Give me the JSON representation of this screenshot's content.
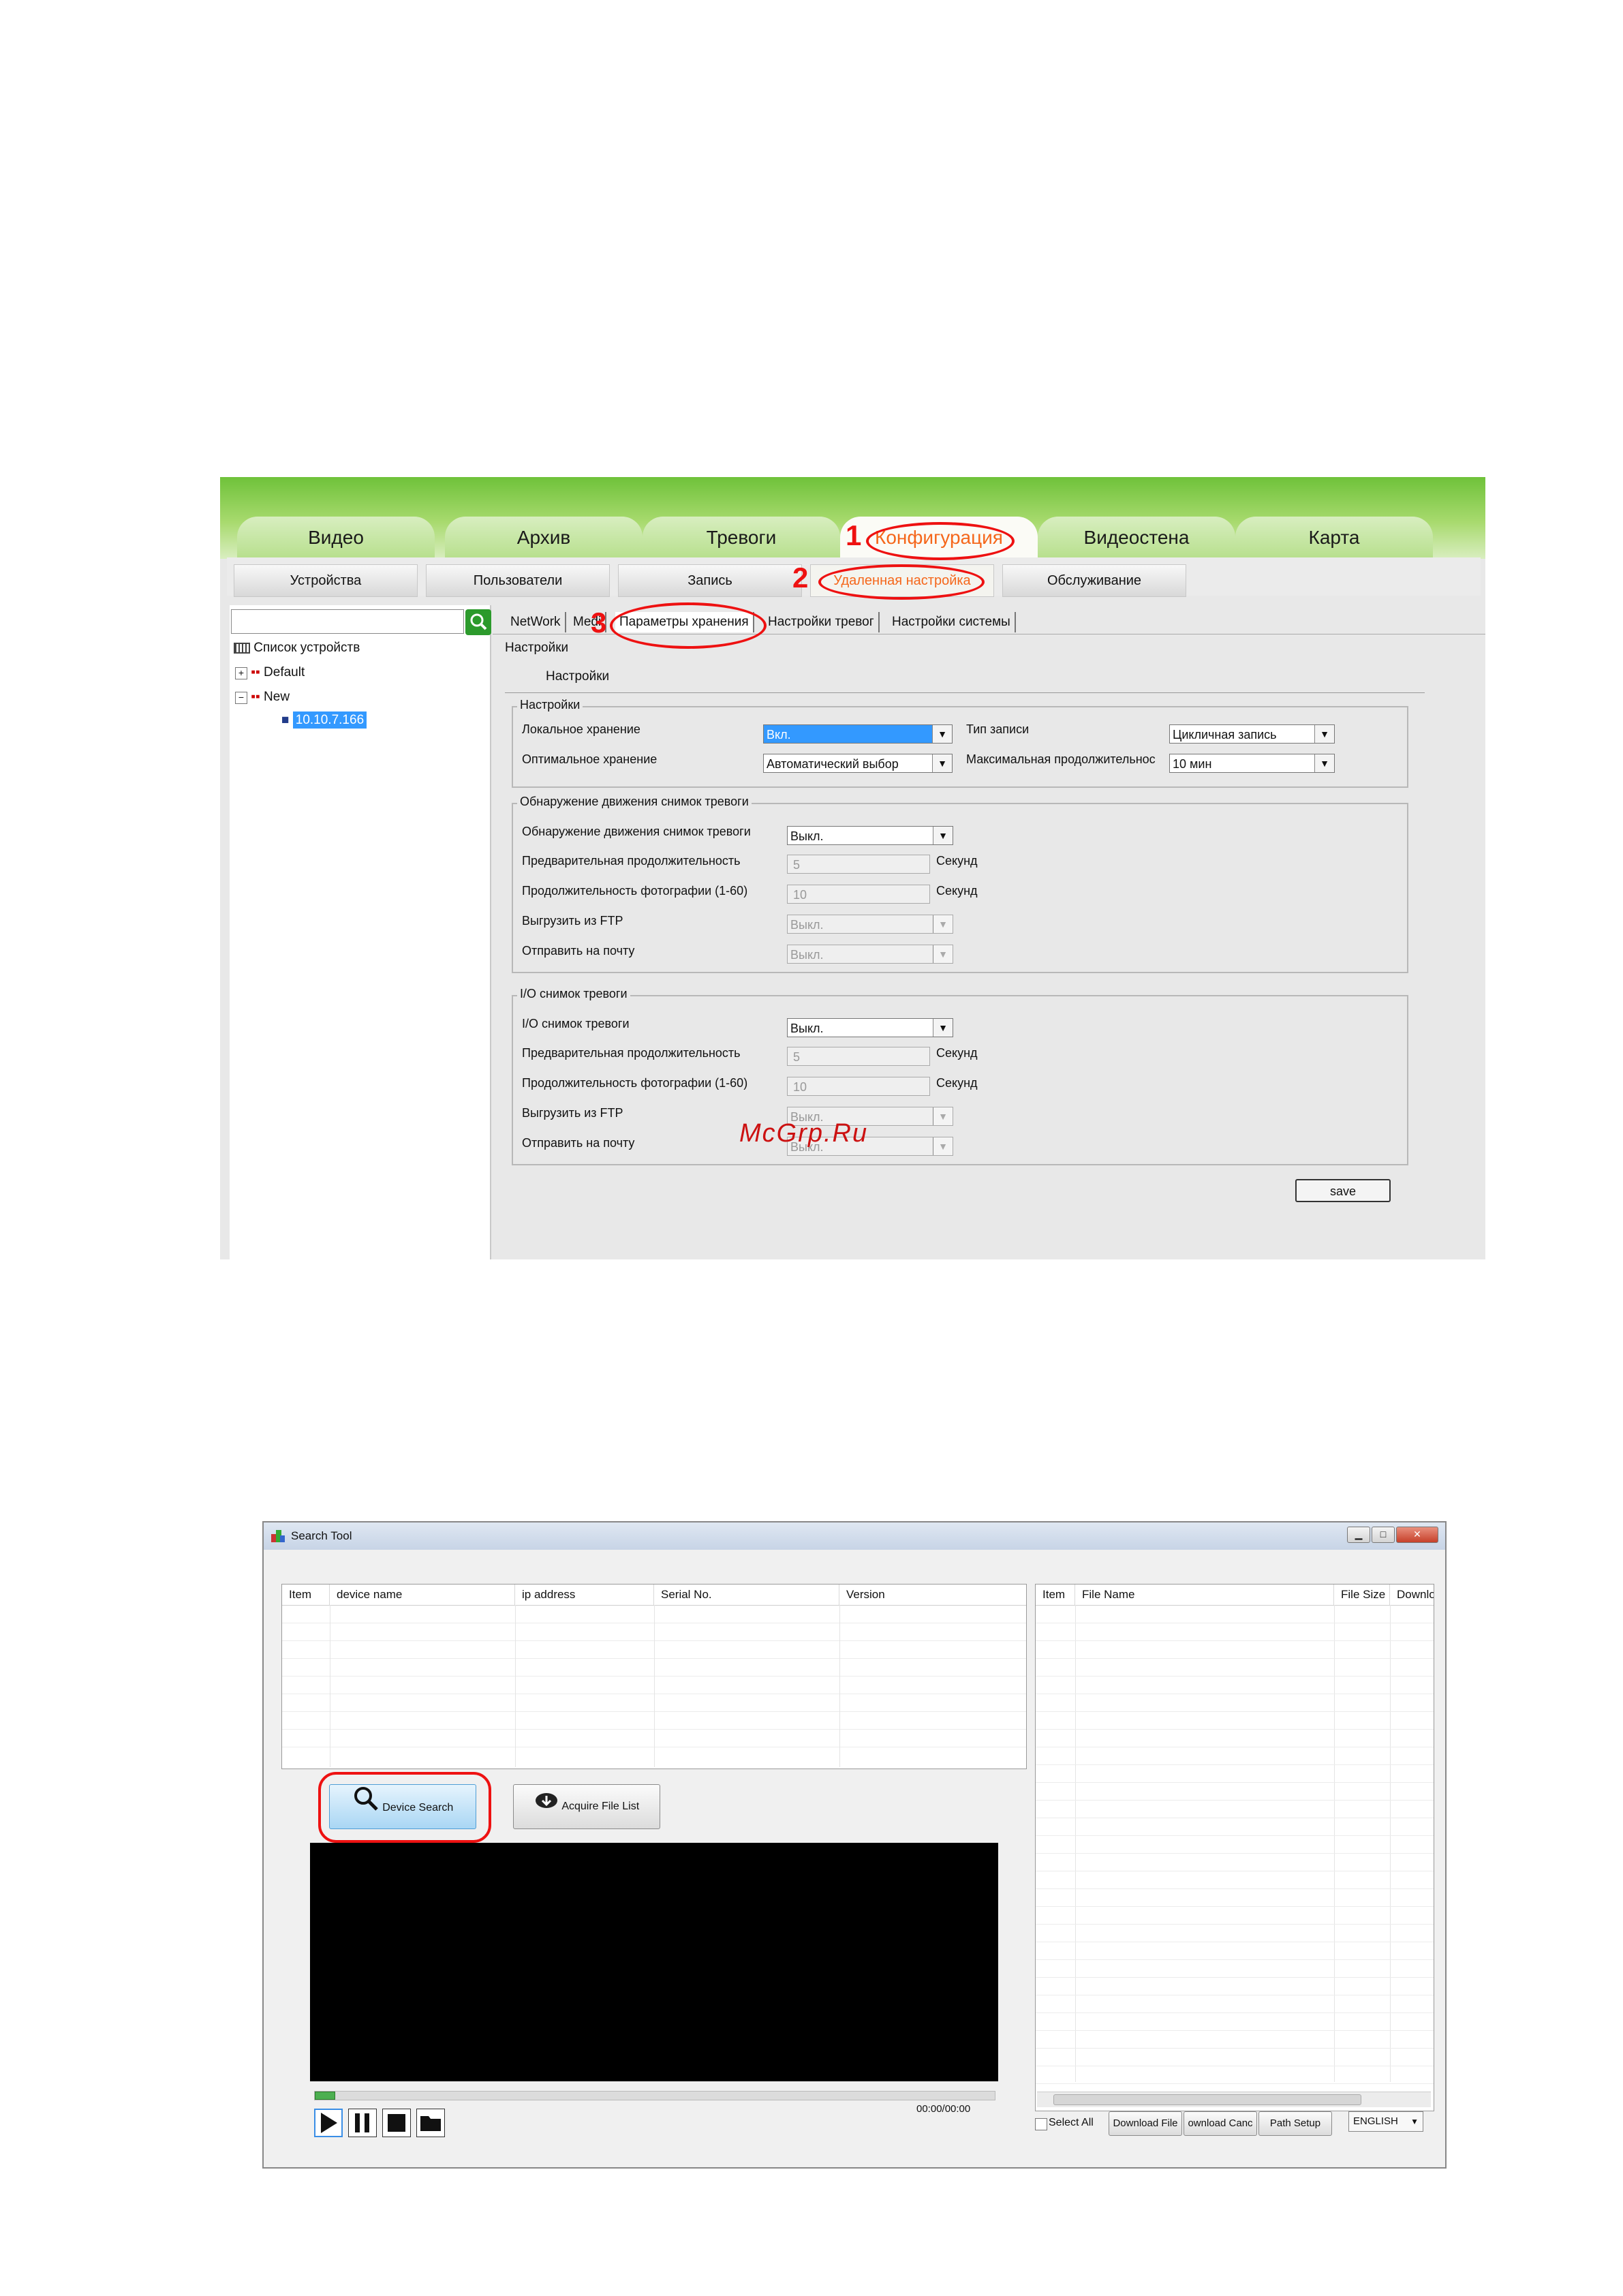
{
  "shot1": {
    "main_tabs": [
      "Видео",
      "Архив",
      "Тревоги",
      "Конфигурация",
      "Видеостена",
      "Карта"
    ],
    "active_main_tab": "Конфигурация",
    "sub_tabs": [
      "Устройства",
      "Пользователи",
      "Запись",
      "Удаленная настройка",
      "Обслуживание"
    ],
    "active_sub_tab": "Удаленная настройка",
    "annotations": [
      "1",
      "2",
      "3"
    ],
    "tree": {
      "root": "Список устройств",
      "nodes": [
        "Default",
        "New"
      ],
      "device_ip": "10.10.7.166"
    },
    "config_tabs": [
      "NetWork",
      "Medi",
      "Параметры хранения",
      "Настройки тревог",
      "Настройки системы"
    ],
    "inner_tab": "Настройки",
    "inner_subtab": "Настройки",
    "group_settings": {
      "title": "Настройки",
      "local_storage_label": "Локальное хранение",
      "local_storage_value": "Вкл.",
      "optimal_storage_label": "Оптимальное хранение",
      "optimal_storage_value": "Автоматический выбор",
      "record_type_label": "Тип записи",
      "record_type_value": "Цикличная запись",
      "max_duration_label": "Максимальная продолжительнос",
      "max_duration_value": "10 мин"
    },
    "group_motion": {
      "title": "Обнаружение движения снимок тревоги",
      "motion_label": "Обнаружение движения снимок тревоги",
      "motion_value": "Выкл.",
      "pre_duration_label": "Предварительная продолжительность",
      "pre_duration_value": "5",
      "photo_duration_label": "Продолжительность фотографии (1-60)",
      "photo_duration_value": "10",
      "ftp_label": "Выгрузить из FTP",
      "ftp_value": "Выкл.",
      "mail_label": "Отправить на почту",
      "mail_value": "Выкл.",
      "seconds": "Секунд"
    },
    "group_io": {
      "title": "I/O снимок тревоги",
      "io_label": "I/O снимок тревоги",
      "io_value": "Выкл.",
      "pre_duration_label": "Предварительная продолжительность",
      "pre_duration_value": "5",
      "photo_duration_label": "Продолжительность фотографии (1-60)",
      "photo_duration_value": "10",
      "ftp_label": "Выгрузить из FTP",
      "ftp_value": "Выкл.",
      "mail_label": "Отправить на почту",
      "mail_value": "Выкл.",
      "seconds": "Секунд"
    },
    "save_label": "save",
    "watermark": "McGrp.Ru"
  },
  "shot2": {
    "window_title": "Search Tool",
    "device_columns": [
      "Item",
      "device name",
      "ip address",
      "Serial No.",
      "Version"
    ],
    "file_columns": [
      "Item",
      "File Name",
      "File Size",
      "Downlo"
    ],
    "device_search_label": "Device Search",
    "acquire_file_list_label": "Acquire File List",
    "time_display": "00:00/00:00",
    "select_all_label": "Select All",
    "download_file_label": "Download File",
    "download_cancel_label": "ownload Canc",
    "path_setup_label": "Path Setup",
    "language_value": "ENGLISH",
    "colors": {
      "accent_green": "#6fc23a",
      "highlight_orange": "#f5671b",
      "annotation_red": "#e11111"
    }
  }
}
